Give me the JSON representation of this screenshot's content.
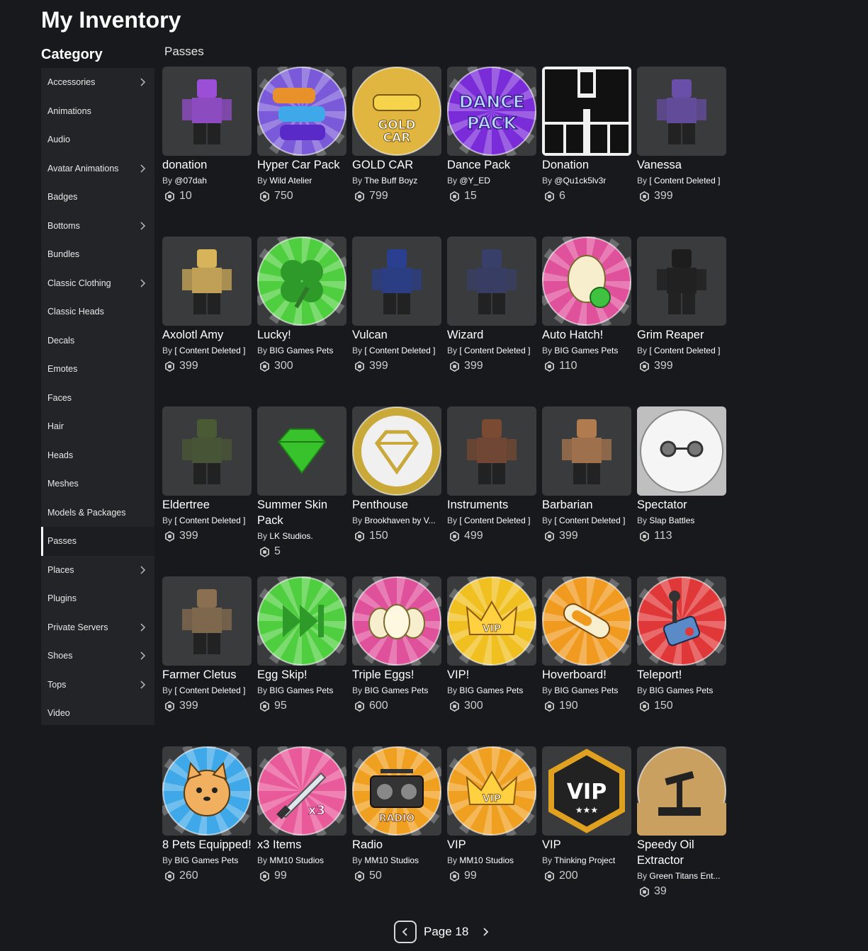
{
  "page": {
    "title": "My Inventory",
    "category_heading": "Category",
    "section_heading": "Passes"
  },
  "sidebar": {
    "items": [
      {
        "label": "Accessories",
        "chevron": true
      },
      {
        "label": "Animations",
        "chevron": false
      },
      {
        "label": "Audio",
        "chevron": false
      },
      {
        "label": "Avatar Animations",
        "chevron": true
      },
      {
        "label": "Badges",
        "chevron": false
      },
      {
        "label": "Bottoms",
        "chevron": true
      },
      {
        "label": "Bundles",
        "chevron": false
      },
      {
        "label": "Classic Clothing",
        "chevron": true
      },
      {
        "label": "Classic Heads",
        "chevron": false
      },
      {
        "label": "Decals",
        "chevron": false
      },
      {
        "label": "Emotes",
        "chevron": false
      },
      {
        "label": "Faces",
        "chevron": false
      },
      {
        "label": "Hair",
        "chevron": false
      },
      {
        "label": "Heads",
        "chevron": false
      },
      {
        "label": "Meshes",
        "chevron": false
      },
      {
        "label": "Models & Packages",
        "chevron": false
      },
      {
        "label": "Passes",
        "chevron": false,
        "active": true
      },
      {
        "label": "Places",
        "chevron": true
      },
      {
        "label": "Plugins",
        "chevron": false
      },
      {
        "label": "Private Servers",
        "chevron": true
      },
      {
        "label": "Shoes",
        "chevron": true
      },
      {
        "label": "Tops",
        "chevron": true
      },
      {
        "label": "Video",
        "chevron": false
      }
    ]
  },
  "items": [
    {
      "name": "donation",
      "by": "By",
      "creator": "@07dah",
      "price": "10",
      "icon": "avatar-icon",
      "color": "#9b4fd6"
    },
    {
      "name": "Hyper Car Pack",
      "by": "By",
      "creator": "Wild Atelier",
      "price": "750",
      "icon": "cars-icon",
      "color": "#7a5ad8"
    },
    {
      "name": "GOLD CAR",
      "by": "By",
      "creator": "The Buff Boyz",
      "price": "799",
      "icon": "gold-car-icon",
      "color": "#e0b640"
    },
    {
      "name": "Dance Pack",
      "by": "By",
      "creator": "@Y_ED",
      "price": "15",
      "icon": "dance-pack-icon",
      "color": "#7b2cd9"
    },
    {
      "name": "Donation",
      "by": "By",
      "creator": "@Qu1ck5lv3r",
      "price": "6",
      "icon": "shirt-template-icon",
      "color": "#222222"
    },
    {
      "name": "Vanessa",
      "by": "By",
      "creator": "[ Content Deleted ]",
      "price": "399",
      "icon": "avatar-icon",
      "color": "#6a4fa8"
    },
    {
      "name": "Axolotl Amy",
      "by": "By",
      "creator": "[ Content Deleted ]",
      "price": "399",
      "icon": "avatar-icon",
      "color": "#d7b35a"
    },
    {
      "name": "Lucky!",
      "by": "By",
      "creator": "BIG Games Pets",
      "price": "300",
      "icon": "clover-icon",
      "color": "#4fcf3f"
    },
    {
      "name": "Vulcan",
      "by": "By",
      "creator": "[ Content Deleted ]",
      "price": "399",
      "icon": "avatar-icon",
      "color": "#2a3f8f"
    },
    {
      "name": "Wizard",
      "by": "By",
      "creator": "[ Content Deleted ]",
      "price": "399",
      "icon": "avatar-icon",
      "color": "#38406a"
    },
    {
      "name": "Auto Hatch!",
      "by": "By",
      "creator": "BIG Games Pets",
      "price": "110",
      "icon": "egg-icon",
      "color": "#e0519c"
    },
    {
      "name": "Grim Reaper",
      "by": "By",
      "creator": "[ Content Deleted ]",
      "price": "399",
      "icon": "avatar-icon",
      "color": "#1d1d1d"
    },
    {
      "name": "Eldertree",
      "by": "By",
      "creator": "[ Content Deleted ]",
      "price": "399",
      "icon": "avatar-icon",
      "color": "#4a5a35"
    },
    {
      "name": "Summer Skin Pack",
      "by": "By",
      "creator": "LK Studios.",
      "price": "5",
      "icon": "gem-icon",
      "color": "#38c22c"
    },
    {
      "name": "Penthouse",
      "by": "By",
      "creator": "Brookhaven by V...",
      "price": "150",
      "icon": "diamond-icon",
      "color": "#c9a93a"
    },
    {
      "name": "Instruments",
      "by": "By",
      "creator": "[ Content Deleted ]",
      "price": "499",
      "icon": "avatar-icon",
      "color": "#7a4a32"
    },
    {
      "name": "Barbarian",
      "by": "By",
      "creator": "[ Content Deleted ]",
      "price": "399",
      "icon": "avatar-icon",
      "color": "#b07b4f"
    },
    {
      "name": "Spectator",
      "by": "By",
      "creator": "Slap Battles",
      "price": "113",
      "icon": "mask-icon",
      "color": "#e8e8e8"
    },
    {
      "name": "Farmer Cletus",
      "by": "By",
      "creator": "[ Content Deleted ]",
      "price": "399",
      "icon": "avatar-icon",
      "color": "#8a7050"
    },
    {
      "name": "Egg Skip!",
      "by": "By",
      "creator": "BIG Games Pets",
      "price": "95",
      "icon": "skip-icon",
      "color": "#4fcf3f"
    },
    {
      "name": "Triple Eggs!",
      "by": "By",
      "creator": "BIG Games Pets",
      "price": "600",
      "icon": "eggs-icon",
      "color": "#e0519c"
    },
    {
      "name": "VIP!",
      "by": "By",
      "creator": "BIG Games Pets",
      "price": "300",
      "icon": "crown-icon",
      "color": "#f0c020"
    },
    {
      "name": "Hoverboard!",
      "by": "By",
      "creator": "BIG Games Pets",
      "price": "190",
      "icon": "hoverboard-icon",
      "color": "#f09a20"
    },
    {
      "name": "Teleport!",
      "by": "By",
      "creator": "BIG Games Pets",
      "price": "150",
      "icon": "joystick-icon",
      "color": "#e03838"
    },
    {
      "name": "8 Pets Equipped!",
      "by": "By",
      "creator": "BIG Games Pets",
      "price": "260",
      "icon": "pet-icon",
      "color": "#3fa8e8"
    },
    {
      "name": "x3 Items",
      "by": "By",
      "creator": "MM10 Studios",
      "price": "99",
      "icon": "knife-icon",
      "color": "#e85a9a"
    },
    {
      "name": "Radio",
      "by": "By",
      "creator": "MM10 Studios",
      "price": "50",
      "icon": "radio-icon",
      "color": "#f0a020"
    },
    {
      "name": "VIP",
      "by": "By",
      "creator": "MM10 Studios",
      "price": "99",
      "icon": "crown-icon",
      "color": "#f0a020"
    },
    {
      "name": "VIP",
      "by": "By",
      "creator": "Thinking Project",
      "price": "200",
      "icon": "vip-hex-icon",
      "color": "#e0a020"
    },
    {
      "name": "Speedy Oil Extractor",
      "by": "By",
      "creator": "Green Titans Ent...",
      "price": "39",
      "icon": "oil-pump-icon",
      "color": "#c9a060"
    }
  ],
  "pagination": {
    "label": "Page 18"
  }
}
